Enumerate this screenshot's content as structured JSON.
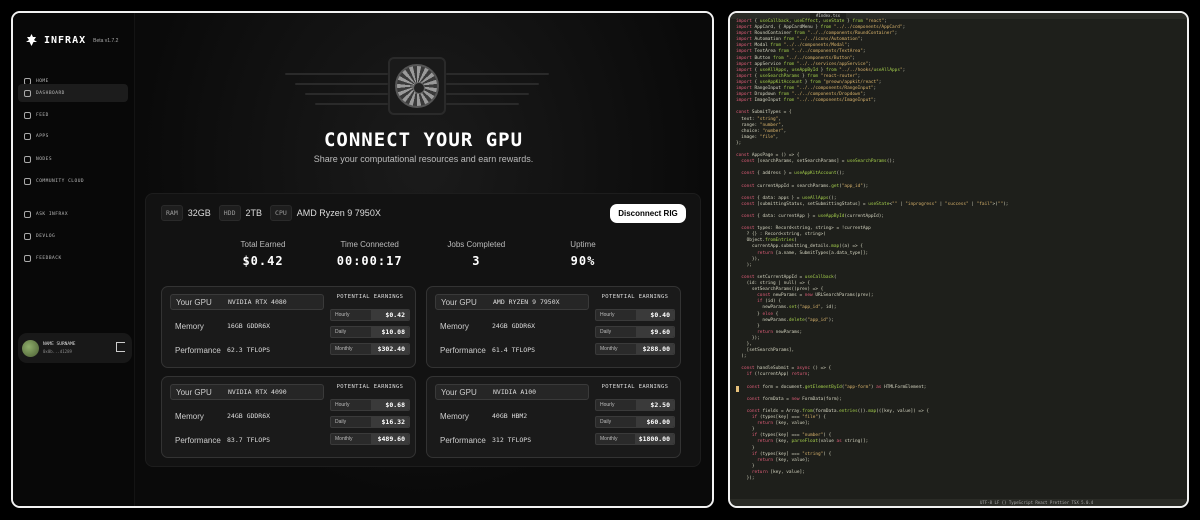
{
  "app": {
    "name": "INFRAX",
    "version": "Beta v1.7.2"
  },
  "sidebar": {
    "items": [
      {
        "label": "HOME",
        "icon": "home-icon"
      },
      {
        "label": "DASHBOARD",
        "icon": "dashboard-icon"
      },
      {
        "label": "FEED",
        "icon": "feed-icon"
      },
      {
        "label": "APPS",
        "icon": "apps-icon"
      },
      {
        "label": "NODES",
        "icon": "nodes-icon"
      },
      {
        "label": "COMMUNITY CLOUD",
        "icon": "cloud-icon"
      },
      {
        "label": "ASK INFRAX",
        "icon": "ask-icon"
      },
      {
        "label": "DEVLOG",
        "icon": "devlog-icon"
      },
      {
        "label": "FEEDBACK",
        "icon": "feedback-icon"
      }
    ],
    "active": "DASHBOARD",
    "user": {
      "name": "NAME SURNAME",
      "handle": "0x0b...d1289"
    }
  },
  "hero": {
    "title": "CONNECT YOUR GPU",
    "subtitle": "Share your computational resources and earn rewards."
  },
  "specs": {
    "ram_label": "RAM",
    "ram_value": "32GB",
    "hdd_label": "HDD",
    "hdd_value": "2TB",
    "cpu_label": "CPU",
    "cpu_value": "AMD Ryzen 9 7950X"
  },
  "disconnect_label": "Disconnect RIG",
  "stats": [
    {
      "label": "Total Earned",
      "value": "$0.42"
    },
    {
      "label": "Time Connected",
      "value": "00:00:17"
    },
    {
      "label": "Jobs Completed",
      "value": "3"
    },
    {
      "label": "Uptime",
      "value": "90%"
    }
  ],
  "gpu_card_labels": {
    "gpu": "Your GPU",
    "memory": "Memory",
    "performance": "Performance",
    "earnings": "POTENTIAL EARNINGS",
    "hourly": "Hourly",
    "daily": "Daily",
    "monthly": "Monthly"
  },
  "gpus": [
    {
      "name": "NVIDIA RTX 4080",
      "memory": "16GB GDDR6X",
      "performance": "62.3 TFLOPS",
      "hourly": "$0.42",
      "daily": "$10.08",
      "monthly": "$302.40"
    },
    {
      "name": "AMD RYZEN 9 7950X",
      "memory": "24GB GDDR6X",
      "performance": "61.4 TFLOPS",
      "hourly": "$0.40",
      "daily": "$9.60",
      "monthly": "$288.00"
    },
    {
      "name": "NVIDIA RTX 4090",
      "memory": "24GB GDDR6X",
      "performance": "83.7 TFLOPS",
      "hourly": "$0.68",
      "daily": "$16.32",
      "monthly": "$489.60"
    },
    {
      "name": "NVIDIA A100",
      "memory": "40GB HBM2",
      "performance": "312 TFLOPS",
      "hourly": "$2.50",
      "daily": "$60.00",
      "monthly": "$1800.00"
    }
  ],
  "editor": {
    "tab": "#Index.tsx",
    "status": "UTF-8  LF  {} TypeScript React  Prettier  TSX 5.0.4",
    "lines": [
      "import { useCallback, useEffect, useState } from \"react\";",
      "import AppCard, { AppCardMenu } from \"../../components/AppCard\";",
      "import RoundContainer from \"../../components/RoundContainer\";",
      "import Automation from \"../../icons/Automation\";",
      "import Modal from \"../../components/Modal\";",
      "import TextArea from \"../../components/TextArea\";",
      "import Button from \"../../components/Button\";",
      "import appService from \"../../services/appService\";",
      "import { useAllApps, useAppById } from \"../../hooks/useAllApps\";",
      "import { useSearchParams } from \"react-router\";",
      "import { useAppKitAccount } from \"@reown/appkit/react\";",
      "import RangeInput from \"../../components/RangeInput\";",
      "import Dropdown from \"../../components/Dropdown\";",
      "import ImageInput from \"../../components/ImageInput\";",
      "",
      "const SubmitTypes = {",
      "  text: \"string\",",
      "  range: \"number\",",
      "  choice: \"number\",",
      "  image: \"file\",",
      "};",
      "",
      "const AppsPage = () => {",
      "  const [searchParams, setSearchParams] = useSearchParams();",
      "",
      "  const { address } = useAppKitAccount();",
      "",
      "  const currentAppId = searchParams.get(\"app_id\");",
      "",
      "  const { data: apps } = useAllApps();",
      "  const [submittingStatus, setSubmittingStatus] = useState<\"\" | \"inprogress\" | \"success\" | \"fail\">(\"\");",
      "",
      "  const { data: currentApp } = useAppById(currentAppId);",
      "",
      "  const types: Record<string, string> = !currentApp",
      "    ? {} : Record<string, string>)",
      "    Object.fromEntries(",
      "      currentApp.submitting_details.map((a) => {",
      "        return [a.name, SubmitTypes[a.data_type]];",
      "      }),",
      "    );",
      "",
      "  const setCurrentAppId = useCallback(",
      "    (id: string | null) => {",
      "      setSearchParams((prev) => {",
      "        const newParams = new URLSearchParams(prev);",
      "        if (id) {",
      "          newParams.set(\"app_id\", id);",
      "        } else {",
      "          newParams.delete(\"app_id\");",
      "        }",
      "        return newParams;",
      "      });",
      "    },",
      "    [setSearchParams],",
      "  );",
      "",
      "  const handleSubmit = async () => {",
      "    if (!currentApp) return;",
      "",
      "    const form = document.getElementById(\"app-form\") as HTMLFormElement;",
      "",
      "    const formData = new FormData(form);",
      "",
      "    const fields = Array.from(formData.entries()).map(([key, value]) => {",
      "      if (types[key] === \"file\") {",
      "        return [key, value];",
      "      }",
      "      if (types[key] === \"number\") {",
      "        return [key, parseFloat(value as string)];",
      "      }",
      "      if (types[key] === \"string\") {",
      "        return [key, value];",
      "      }",
      "      return [key, value];",
      "    });"
    ]
  }
}
